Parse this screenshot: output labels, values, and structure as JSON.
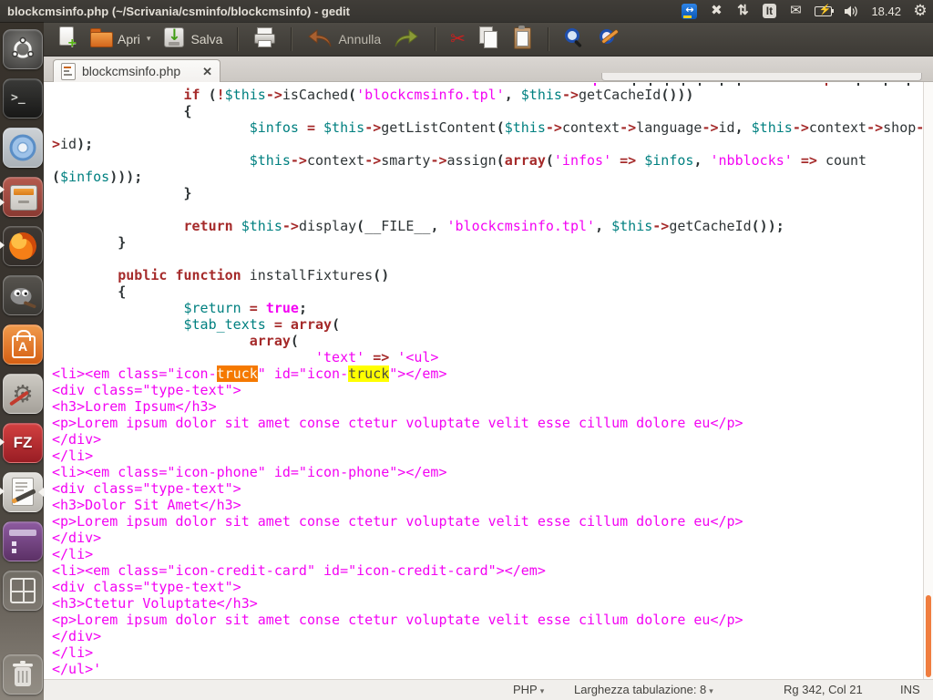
{
  "panel": {
    "title": "blockcmsinfo.php (~/Scrivania/csminfo/blockcmsinfo) - gedit",
    "tray": [
      {
        "name": "teamviewer"
      },
      {
        "name": "indicator-cross"
      },
      {
        "name": "network-arrows"
      },
      {
        "name": "keyboard-layout",
        "label": "It"
      },
      {
        "name": "messages"
      },
      {
        "name": "battery"
      },
      {
        "name": "volume"
      },
      {
        "name": "clock",
        "label": "18.42"
      },
      {
        "name": "session-gear"
      }
    ]
  },
  "toolbar": {
    "open_label": "Apri",
    "save_label": "Salva",
    "undo_label": "Annulla"
  },
  "tabbar": {
    "tab_label": "blockcmsinfo.php",
    "close_glyph": "✕"
  },
  "launcher": {
    "items": [
      {
        "name": "dash"
      },
      {
        "name": "terminal"
      },
      {
        "name": "chromium"
      },
      {
        "name": "file-archiver",
        "pips": 2
      },
      {
        "name": "firefox",
        "pips": 1
      },
      {
        "name": "gimp"
      },
      {
        "name": "software-center"
      },
      {
        "name": "system-settings"
      },
      {
        "name": "filezilla",
        "pips": 1
      },
      {
        "name": "gedit",
        "pips": 1,
        "focused": true
      },
      {
        "name": "purple-app"
      },
      {
        "name": "workspace-switcher"
      },
      {
        "name": "trash",
        "bottom": true
      }
    ]
  },
  "statusbar": {
    "language": "PHP",
    "tab_width": "Larghezza tabulazione: 8",
    "cursor": "Rg 342, Col 21",
    "mode": "INS"
  },
  "colors": {
    "keyword": "#a52a2a",
    "variable": "#008080",
    "string": "#f303f3",
    "match_selected_bg": "#f57900",
    "match_bg": "#ffff00",
    "scrollbar_thumb": "#f07d3e"
  },
  "editor": {
    "rows": [
      [
        [
          "d",
          "                "
        ],
        [
          "k",
          "if"
        ],
        [
          "d",
          " "
        ],
        [
          "p",
          "("
        ],
        [
          "o",
          "!"
        ],
        [
          "v",
          "$this"
        ],
        [
          "o",
          "->"
        ],
        [
          "d",
          "isCached"
        ],
        [
          "p",
          "("
        ],
        [
          "s",
          "'blockcmsinfo.tpl'"
        ],
        [
          "p",
          ","
        ],
        [
          "d",
          " "
        ],
        [
          "v",
          "$this"
        ],
        [
          "o",
          "->"
        ],
        [
          "d",
          "getCacheId"
        ],
        [
          "p",
          "()))"
        ]
      ],
      [
        [
          "d",
          "                "
        ],
        [
          "p",
          "{"
        ]
      ],
      [
        [
          "d",
          "                        "
        ],
        [
          "v",
          "$infos"
        ],
        [
          "d",
          " "
        ],
        [
          "o",
          "="
        ],
        [
          "d",
          " "
        ],
        [
          "v",
          "$this"
        ],
        [
          "o",
          "->"
        ],
        [
          "d",
          "getListContent"
        ],
        [
          "p",
          "("
        ],
        [
          "v",
          "$this"
        ],
        [
          "o",
          "->"
        ],
        [
          "d",
          "context"
        ],
        [
          "o",
          "->"
        ],
        [
          "d",
          "language"
        ],
        [
          "o",
          "->"
        ],
        [
          "d",
          "id"
        ],
        [
          "p",
          ","
        ],
        [
          "d",
          " "
        ],
        [
          "v",
          "$this"
        ],
        [
          "o",
          "->"
        ],
        [
          "d",
          "context"
        ],
        [
          "o",
          "->"
        ],
        [
          "d",
          "shop"
        ],
        [
          "o",
          "-"
        ]
      ],
      [
        [
          "o",
          ">"
        ],
        [
          "d",
          "id"
        ],
        [
          "p",
          ");"
        ]
      ],
      [
        [
          "d",
          "                        "
        ],
        [
          "v",
          "$this"
        ],
        [
          "o",
          "->"
        ],
        [
          "d",
          "context"
        ],
        [
          "o",
          "->"
        ],
        [
          "d",
          "smarty"
        ],
        [
          "o",
          "->"
        ],
        [
          "d",
          "assign"
        ],
        [
          "p",
          "("
        ],
        [
          "k",
          "array"
        ],
        [
          "p",
          "("
        ],
        [
          "s",
          "'infos'"
        ],
        [
          "d",
          " "
        ],
        [
          "o",
          "=>"
        ],
        [
          "d",
          " "
        ],
        [
          "v",
          "$infos"
        ],
        [
          "p",
          ","
        ],
        [
          "d",
          " "
        ],
        [
          "s",
          "'nbblocks'"
        ],
        [
          "d",
          " "
        ],
        [
          "o",
          "=>"
        ],
        [
          "d",
          " "
        ],
        [
          "d",
          "count"
        ]
      ],
      [
        [
          "p",
          "("
        ],
        [
          "v",
          "$infos"
        ],
        [
          "p",
          ")));"
        ]
      ],
      [
        [
          "d",
          "                "
        ],
        [
          "p",
          "}"
        ]
      ],
      [],
      [
        [
          "d",
          "                "
        ],
        [
          "k",
          "return"
        ],
        [
          "d",
          " "
        ],
        [
          "v",
          "$this"
        ],
        [
          "o",
          "->"
        ],
        [
          "d",
          "display"
        ],
        [
          "p",
          "("
        ],
        [
          "d",
          "__FILE__"
        ],
        [
          "p",
          ","
        ],
        [
          "d",
          " "
        ],
        [
          "s",
          "'blockcmsinfo.tpl'"
        ],
        [
          "p",
          ","
        ],
        [
          "d",
          " "
        ],
        [
          "v",
          "$this"
        ],
        [
          "o",
          "->"
        ],
        [
          "d",
          "getCacheId"
        ],
        [
          "p",
          "());"
        ]
      ],
      [
        [
          "d",
          "        "
        ],
        [
          "p",
          "}"
        ]
      ],
      [],
      [
        [
          "d",
          "        "
        ],
        [
          "k",
          "public"
        ],
        [
          "d",
          " "
        ],
        [
          "k",
          "function"
        ],
        [
          "d",
          " "
        ],
        [
          "d",
          "installFixtures"
        ],
        [
          "p",
          "()"
        ]
      ],
      [
        [
          "d",
          "        "
        ],
        [
          "p",
          "{"
        ]
      ],
      [
        [
          "d",
          "                "
        ],
        [
          "v",
          "$return"
        ],
        [
          "d",
          " "
        ],
        [
          "o",
          "="
        ],
        [
          "d",
          " "
        ],
        [
          "b",
          "true"
        ],
        [
          "p",
          ";"
        ]
      ],
      [
        [
          "d",
          "                "
        ],
        [
          "v",
          "$tab_texts"
        ],
        [
          "d",
          " "
        ],
        [
          "o",
          "="
        ],
        [
          "d",
          " "
        ],
        [
          "k",
          "array"
        ],
        [
          "p",
          "("
        ]
      ],
      [
        [
          "d",
          "                        "
        ],
        [
          "k",
          "array"
        ],
        [
          "p",
          "("
        ]
      ],
      [
        [
          "d",
          "                                "
        ],
        [
          "s",
          "'text'"
        ],
        [
          "d",
          " "
        ],
        [
          "o",
          "=>"
        ],
        [
          "d",
          " "
        ],
        [
          "s",
          "'<ul>"
        ]
      ],
      [
        [
          "s",
          "<li><em class=\"icon-"
        ],
        [
          "hs",
          "truck"
        ],
        [
          "s",
          "\" id=\"icon-"
        ],
        [
          "hm",
          "truck"
        ],
        [
          "s",
          "\"></em>"
        ]
      ],
      [
        [
          "s",
          "<div class=\"type-text\">"
        ]
      ],
      [
        [
          "s",
          "<h3>Lorem Ipsum</h3>"
        ]
      ],
      [
        [
          "s",
          "<p>Lorem ipsum dolor sit amet conse ctetur voluptate velit esse cillum dolore eu</p>"
        ]
      ],
      [
        [
          "s",
          "</div>"
        ]
      ],
      [
        [
          "s",
          "</li>"
        ]
      ],
      [
        [
          "s",
          "<li><em class=\"icon-phone\" id=\"icon-phone\"></em>"
        ]
      ],
      [
        [
          "s",
          "<div class=\"type-text\">"
        ]
      ],
      [
        [
          "s",
          "<h3>Dolor Sit Amet</h3>"
        ]
      ],
      [
        [
          "s",
          "<p>Lorem ipsum dolor sit amet conse ctetur voluptate velit esse cillum dolore eu</p>"
        ]
      ],
      [
        [
          "s",
          "</div>"
        ]
      ],
      [
        [
          "s",
          "</li>"
        ]
      ],
      [
        [
          "s",
          "<li><em class=\"icon-credit-card\" id=\"icon-credit-card\"></em>"
        ]
      ],
      [
        [
          "s",
          "<div class=\"type-text\">"
        ]
      ],
      [
        [
          "s",
          "<h3>Ctetur Voluptate</h3>"
        ]
      ],
      [
        [
          "s",
          "<p>Lorem ipsum dolor sit amet conse ctetur voluptate velit esse cillum dolore eu</p>"
        ]
      ],
      [
        [
          "s",
          "</div>"
        ]
      ],
      [
        [
          "s",
          "</li>"
        ]
      ],
      [
        [
          "s",
          "</ul>'"
        ]
      ]
    ]
  }
}
